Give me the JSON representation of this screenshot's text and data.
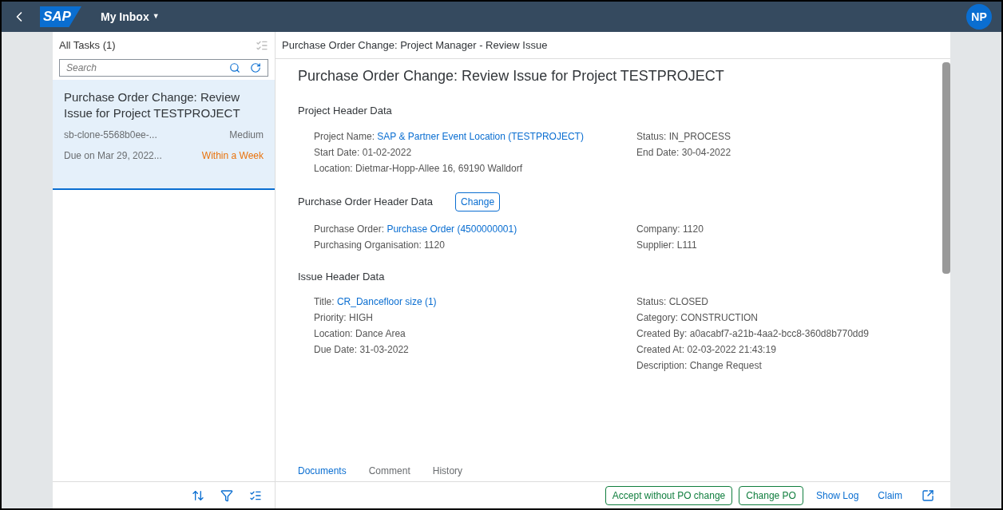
{
  "shell": {
    "logo": "SAP",
    "title": "My Inbox",
    "caret": "▼",
    "avatar": "NP"
  },
  "master": {
    "title": "All Tasks (1)",
    "search": {
      "placeholder": "Search"
    },
    "tasks": [
      {
        "title": "Purchase Order Change: Review Issue for Project TESTPROJECT",
        "id": "sb-clone-5568b0ee-...",
        "priority": "Medium",
        "due": "Due on Mar 29, 2022...",
        "urgency": "Within a Week",
        "selected": true
      }
    ]
  },
  "detail": {
    "header": "Purchase Order Change: Project Manager - Review Issue",
    "title": "Purchase Order Change: Review Issue for Project TESTPROJECT",
    "sections": [
      {
        "title": "Project Header Data",
        "left": [
          {
            "label": "Project Name: ",
            "value": "SAP & Partner Event Location (TESTPROJECT)",
            "link": true
          },
          {
            "label": "Start Date: ",
            "value": "01-02-2022",
            "link": false
          },
          {
            "label": "Location: ",
            "value": "Dietmar-Hopp-Allee 16, 69190 Walldorf",
            "link": false
          }
        ],
        "right": [
          {
            "label": "Status: ",
            "value": "IN_PROCESS",
            "link": false
          },
          {
            "label": "End Date: ",
            "value": "30-04-2022",
            "link": false
          }
        ]
      },
      {
        "title": "Purchase Order Header Data",
        "button": "Change",
        "left": [
          {
            "label": "Purchase Order: ",
            "value": "Purchase Order (4500000001)",
            "link": true
          },
          {
            "label": "Purchasing Organisation: ",
            "value": "1120",
            "link": false
          }
        ],
        "right": [
          {
            "label": "Company: ",
            "value": "1120",
            "link": false
          },
          {
            "label": "Supplier: ",
            "value": "L111",
            "link": false
          }
        ]
      },
      {
        "title": "Issue Header Data",
        "left": [
          {
            "label": "Title: ",
            "value": "CR_Dancefloor size (1)",
            "link": true
          },
          {
            "label": "Priority: ",
            "value": "HIGH",
            "link": false
          },
          {
            "label": "Location: ",
            "value": "Dance Area",
            "link": false
          },
          {
            "label": "Due Date: ",
            "value": "31-03-2022",
            "link": false
          }
        ],
        "right": [
          {
            "label": "Status: ",
            "value": "CLOSED",
            "link": false
          },
          {
            "label": "Category: ",
            "value": "CONSTRUCTION",
            "link": false
          },
          {
            "label": "Created By: ",
            "value": "a0acabf7-a21b-4aa2-bcc8-360d8b770dd9",
            "link": false
          },
          {
            "label": "Created At: ",
            "value": "02-03-2022 21:43:19",
            "link": false
          },
          {
            "label": "Description: ",
            "value": "Change Request",
            "link": false
          }
        ]
      }
    ],
    "tabs": [
      {
        "label": "Documents",
        "selected": true
      },
      {
        "label": "Comment",
        "selected": false
      },
      {
        "label": "History",
        "selected": false
      }
    ],
    "actions": [
      {
        "label": "Accept without PO change",
        "kind": "outlined"
      },
      {
        "label": "Change PO",
        "kind": "outlined"
      },
      {
        "label": "Show Log",
        "kind": "link"
      },
      {
        "label": "Claim",
        "kind": "link"
      }
    ]
  }
}
